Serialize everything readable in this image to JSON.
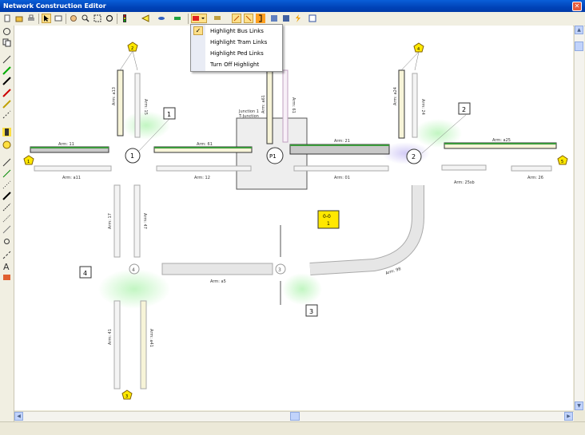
{
  "window": {
    "title": "Network Construction Editor",
    "close_symbol": "✕"
  },
  "menu": {
    "items": [
      {
        "label": "Highlight Bus Links",
        "checked": true
      },
      {
        "label": "Highlight Tram Links",
        "checked": false
      },
      {
        "label": "Highlight Ped Links",
        "checked": false
      },
      {
        "label": "Turn Off Highlight",
        "checked": false
      }
    ],
    "check_symbol": "✓"
  },
  "network": {
    "arm_labels": {
      "a11": "Arm: 11",
      "a11b": "Arm: a11",
      "a61": "Arm: 61",
      "a12": "Arm: 12",
      "a21": "Arm: 21",
      "a01": "Arm: 01",
      "a25": "Arm: a25",
      "a25b": "Arm: 25sb",
      "a26": "Arm: 26",
      "a45": "Arm: a5",
      "a98": "Arm: 98",
      "a13": "Arm: a13",
      "a15": "Arm: 15",
      "a61v": "Arm: a61",
      "a61w": "Arm: 61",
      "a24": "Arm: a24",
      "a24b": "Arm: 24",
      "a17": "Arm: 17",
      "a47": "Arm: 47",
      "a41": "Arm: 41",
      "a41b": "Arm: a41"
    },
    "junction": {
      "title": "Junction 1",
      "subtitle": "T-Junction",
      "id": "P1"
    },
    "nodes": [
      "1",
      "2",
      "3",
      "4"
    ],
    "cubes": [
      "1",
      "2",
      "3",
      "4"
    ],
    "zones": [
      "1",
      "2",
      "3",
      "4",
      "5"
    ],
    "info_box": {
      "line1": "0-0",
      "line2": "1"
    },
    "highlight_color": "#90ee90"
  }
}
